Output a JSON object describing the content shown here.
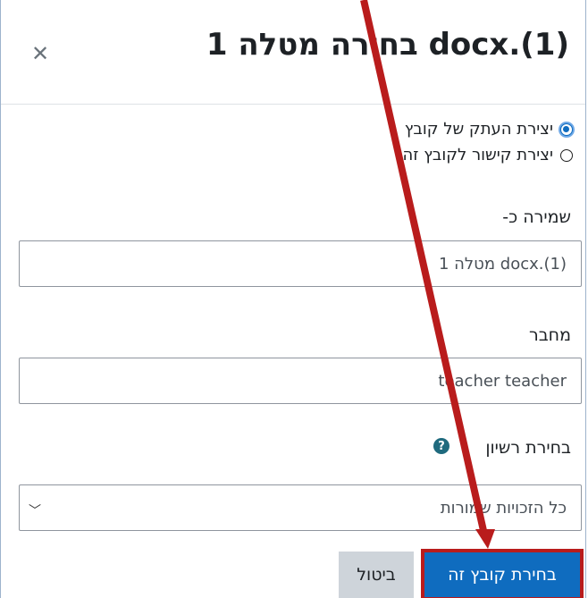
{
  "dialog": {
    "title": "docx.(1) בחירה מטלה 1",
    "close_icon": "close-icon"
  },
  "options": [
    {
      "label": "יצירת העתק של קובץ",
      "checked": true
    },
    {
      "label": "יצירת קישור לקובץ זה",
      "checked": false
    }
  ],
  "save_as": {
    "label": "שמירה כ-",
    "value": "docx.(1) מטלה 1"
  },
  "author": {
    "label": "מחבר",
    "value": "teacher teacher"
  },
  "license": {
    "label": "בחירת רשיון",
    "help_icon": "?",
    "selected": "כל הזכויות שמורות"
  },
  "buttons": {
    "cancel": "ביטול",
    "select": "בחירת קובץ זה"
  },
  "colors": {
    "primary": "#0f6cbf",
    "annotation": "#b91c1c"
  }
}
